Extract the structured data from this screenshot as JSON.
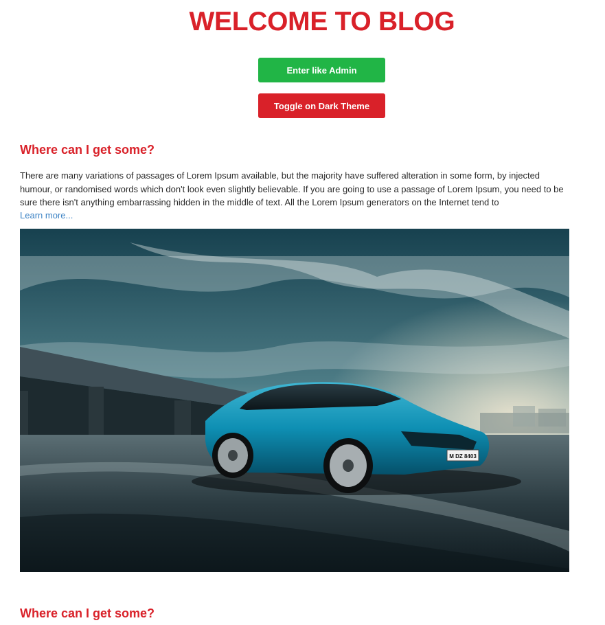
{
  "header": {
    "title": "WELCOME TO BLOG"
  },
  "actions": {
    "admin_label": "Enter like Admin",
    "theme_label": "Toggle on Dark Theme"
  },
  "posts": [
    {
      "title": "Where can I get some?",
      "text": "There are many variations of passages of Lorem Ipsum available, but the majority have suffered alteration in some form, by injected humour, or randomised words which don't look even slightly believable. If you are going to use a passage of Lorem Ipsum, you need to be sure there isn't anything embarrassing hidden in the middle of text. All the Lorem Ipsum generators on the Internet tend to",
      "link": "Learn more...",
      "image": {
        "plate": "M DZ 8403"
      }
    },
    {
      "title": "Where can I get some?"
    }
  ],
  "colors": {
    "accent_red": "#d92129",
    "accent_green": "#21b546",
    "link_blue": "#3b82c4"
  }
}
